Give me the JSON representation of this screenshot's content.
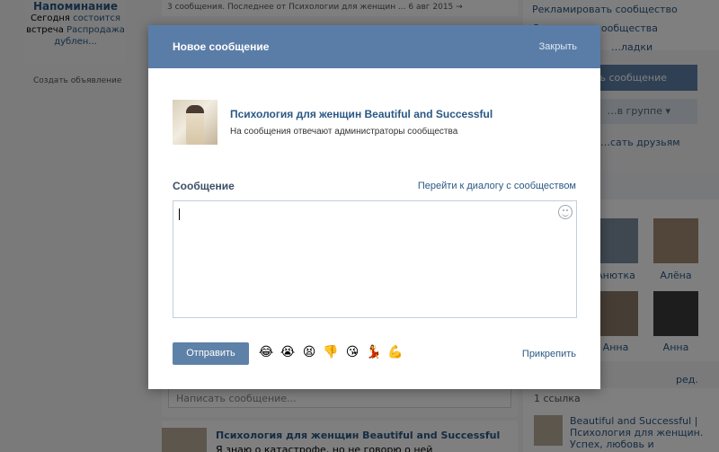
{
  "background": {
    "reminder": {
      "title": "Напоминание",
      "line1": "Сегодня",
      "line1b": "состоится",
      "line2": "встреча",
      "line2b": "Распродажа",
      "line3": "дублен..."
    },
    "create_ad": "Создать объявление",
    "feed_top": "3 сообщения. Последнее от Психологии для женщин ...   6 авг 2015  →",
    "right_top": [
      "Рекламировать сообщество",
      "Статистика сообщества",
      "…ладки"
    ],
    "send_message_btn": "…ить сообщение",
    "in_group_btn": "…в группе ▾",
    "invite_friends": "…сать друзьям",
    "member_names": [
      "Анютка",
      "Алёна",
      "Анна",
      "Анна"
    ],
    "compose_placeholder": "Написать сообщение...",
    "post_title": "Психология для женщин Beautiful and Successful",
    "post_text": "Я знаю о катастрофе, но не говорю о ней",
    "links_header": "1 ссылка",
    "links_item": "Beautiful and Successful | Психология для женщин. Успех, любовь и",
    "red": "ред."
  },
  "modal": {
    "title": "Новое сообщение",
    "close": "Закрыть",
    "community_name": "Психология для женщин Beautiful and Successful",
    "community_desc": "На сообщения отвечают администраторы сообщества",
    "message_label": "Сообщение",
    "goto_dialog": "Перейти к диалогу с сообществом",
    "textarea_value": "",
    "send_label": "Отправить",
    "attach_label": "Прикрепить",
    "emojis": [
      "😂",
      "😭",
      "😫",
      "👎",
      "😘",
      "💃",
      "💪"
    ]
  },
  "colors": {
    "header": "#5a7da8",
    "button": "#5e81a8",
    "link": "#2a5885"
  }
}
